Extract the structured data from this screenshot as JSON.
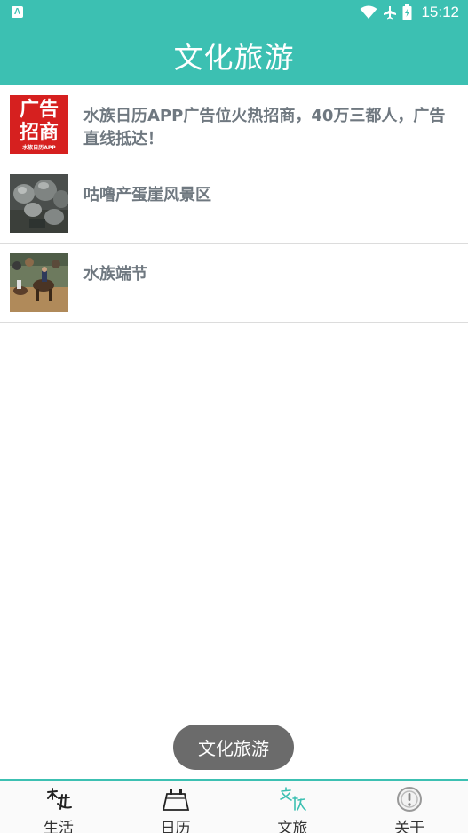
{
  "status_bar": {
    "time": "15:12",
    "badge": "A"
  },
  "header": {
    "title": "文化旅游"
  },
  "list": {
    "items": [
      {
        "title": "水族日历APP广告位火热招商，40万三都人，广告直线抵达！",
        "thumb_line1": "广告",
        "thumb_line2": "招商",
        "thumb_caption": "水族日历APP"
      },
      {
        "title": "咕噜产蛋崖风景区"
      },
      {
        "title": "水族端节"
      }
    ]
  },
  "toast": {
    "text": "文化旅游"
  },
  "tabbar": {
    "tabs": [
      {
        "label": "生活",
        "icon": "calligraphy-local-icon"
      },
      {
        "label": "日历",
        "icon": "calendar-icon"
      },
      {
        "label": "文旅",
        "icon": "calligraphy-culture-icon"
      },
      {
        "label": "关于",
        "icon": "info-icon"
      }
    ]
  },
  "colors": {
    "primary": "#3cc0b2",
    "toast_bg": "#6b6b6b",
    "list_text": "#6f7880"
  }
}
